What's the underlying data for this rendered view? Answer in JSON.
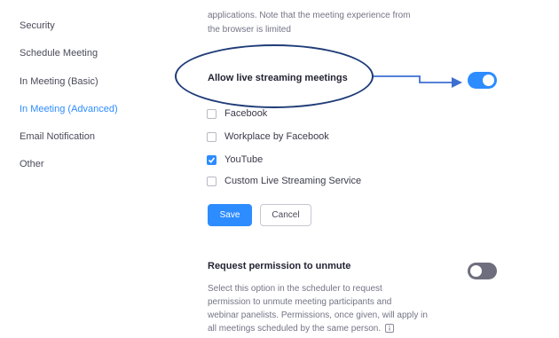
{
  "sidebar": {
    "items": [
      {
        "label": "Security",
        "active": false
      },
      {
        "label": "Schedule Meeting",
        "active": false
      },
      {
        "label": "In Meeting (Basic)",
        "active": false
      },
      {
        "label": "In Meeting (Advanced)",
        "active": true
      },
      {
        "label": "Email Notification",
        "active": false
      },
      {
        "label": "Other",
        "active": false
      }
    ]
  },
  "top_fragment": {
    "line1": "applications. Note that the meeting experience from",
    "line2": "the browser is limited"
  },
  "live_streaming": {
    "title": "Allow live streaming meetings",
    "enabled": true,
    "options": [
      {
        "label": "Facebook",
        "checked": false
      },
      {
        "label": "Workplace by Facebook",
        "checked": false
      },
      {
        "label": "YouTube",
        "checked": true
      },
      {
        "label": "Custom Live Streaming Service",
        "checked": false
      }
    ],
    "save_label": "Save",
    "cancel_label": "Cancel"
  },
  "request_unmute": {
    "title": "Request permission to unmute",
    "enabled": false,
    "description_lines": [
      "Select this option in the scheduler to request",
      "permission to unmute meeting participants and",
      "webinar panelists. Permissions, once given, will apply in",
      "all meetings scheduled by the same person."
    ]
  },
  "colors": {
    "accent": "#2d8cff",
    "annotation": "#1f3c78",
    "arrow": "#3d6fd0",
    "toggle_off": "#6e6e7e"
  },
  "icons": {
    "info": "info-icon",
    "check": "check-icon",
    "arrow": "arrow-right-icon"
  }
}
